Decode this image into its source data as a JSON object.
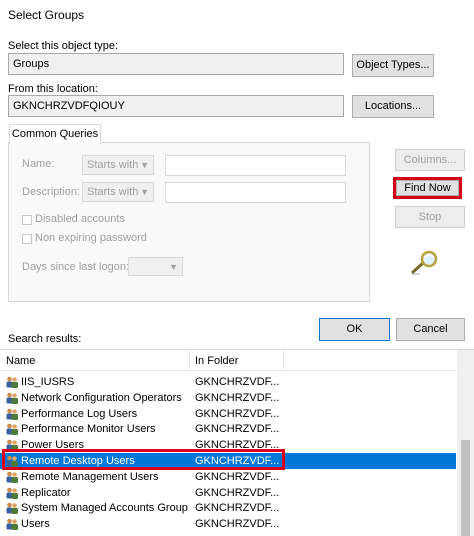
{
  "window": {
    "title": "Select Groups"
  },
  "object_type": {
    "label": "Select this object type:",
    "value": "Groups",
    "button": "Object Types..."
  },
  "location": {
    "label": "From this location:",
    "value": "GKNCHRZVDFQIOUY",
    "button": "Locations..."
  },
  "tabs": [
    {
      "label": "Common Queries"
    }
  ],
  "query": {
    "name_label": "Name:",
    "name_mode": "Starts with",
    "description_label": "Description:",
    "description_mode": "Starts with",
    "disabled_accounts": "Disabled accounts",
    "non_expiring_password": "Non expiring password",
    "days_label": "Days since last logon:"
  },
  "buttons": {
    "columns": "Columns...",
    "find_now": "Find Now",
    "stop": "Stop",
    "ok": "OK",
    "cancel": "Cancel"
  },
  "results": {
    "label": "Search results:",
    "columns": [
      "Name",
      "In Folder"
    ],
    "rows": [
      {
        "name": "IIS_IUSRS",
        "folder": "GKNCHRZVDF..."
      },
      {
        "name": "Network Configuration Operators",
        "folder": "GKNCHRZVDF..."
      },
      {
        "name": "Performance Log Users",
        "folder": "GKNCHRZVDF..."
      },
      {
        "name": "Performance Monitor Users",
        "folder": "GKNCHRZVDF..."
      },
      {
        "name": "Power Users",
        "folder": "GKNCHRZVDF..."
      },
      {
        "name": "Remote Desktop Users",
        "folder": "GKNCHRZVDF...",
        "selected": true
      },
      {
        "name": "Remote Management Users",
        "folder": "GKNCHRZVDF..."
      },
      {
        "name": "Replicator",
        "folder": "GKNCHRZVDF..."
      },
      {
        "name": "System Managed Accounts Group",
        "folder": "GKNCHRZVDF..."
      },
      {
        "name": "Users",
        "folder": "GKNCHRZVDF..."
      }
    ]
  },
  "colors": {
    "selection": "#0078d7",
    "highlight": "#d6001c"
  }
}
